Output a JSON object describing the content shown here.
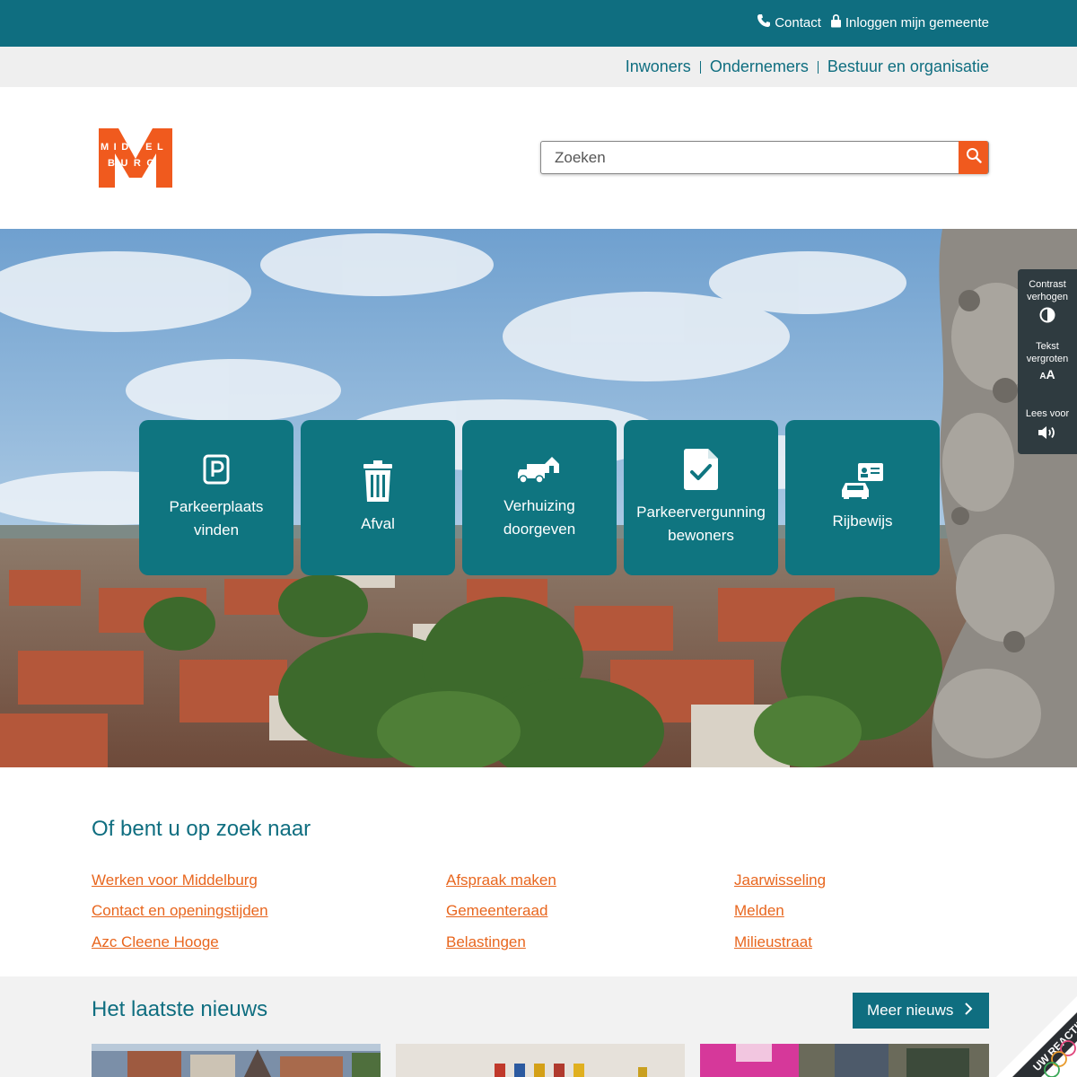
{
  "topbar": {
    "contact_label": "Contact",
    "login_label": "Inloggen mijn gemeente"
  },
  "nav": {
    "items": [
      {
        "label": "Inwoners"
      },
      {
        "label": "Ondernemers"
      },
      {
        "label": "Bestuur en organisatie"
      }
    ]
  },
  "logo": {
    "letter": "M",
    "line1": "MIDDEL",
    "line2": "BURG",
    "color": "#f05a1e"
  },
  "search": {
    "placeholder": "Zoeken"
  },
  "tiles": [
    {
      "label_line1": "Parkeerplaats",
      "label_line2": "vinden",
      "icon": "parking-icon"
    },
    {
      "label_line1": "Afval",
      "label_line2": "",
      "icon": "trash-icon"
    },
    {
      "label_line1": "Verhuizing",
      "label_line2": "doorgeven",
      "icon": "moving-truck-icon"
    },
    {
      "label_line1": "Parkeervergunning",
      "label_line2": "bewoners",
      "icon": "document-check-icon"
    },
    {
      "label_line1": "Rijbewijs",
      "label_line2": "",
      "icon": "drivers-license-icon"
    }
  ],
  "accessibility": {
    "contrast_line1": "Contrast",
    "contrast_line2": "verhogen",
    "text_line1": "Tekst",
    "text_line2": "vergroten",
    "text_glyph": "AA",
    "read_label": "Lees voor"
  },
  "quicklinks": {
    "heading": "Of bent u op zoek naar",
    "col1": [
      "Werken voor Middelburg",
      "Contact en openingstijden",
      "Azc Cleene Hooge"
    ],
    "col2": [
      "Afspraak maken",
      "Gemeenteraad",
      "Belastingen"
    ],
    "col3": [
      "Jaarwisseling",
      "Melden",
      "Milieustraat"
    ]
  },
  "news": {
    "heading": "Het laatste nieuws",
    "more_label": "Meer nieuws"
  },
  "feedback": {
    "label": "UW REACTIE"
  },
  "colors": {
    "brand_teal": "#0f6e80",
    "tile_teal": "#0f7580",
    "accent_orange": "#f05a1e",
    "link_orange": "#e8661e"
  }
}
